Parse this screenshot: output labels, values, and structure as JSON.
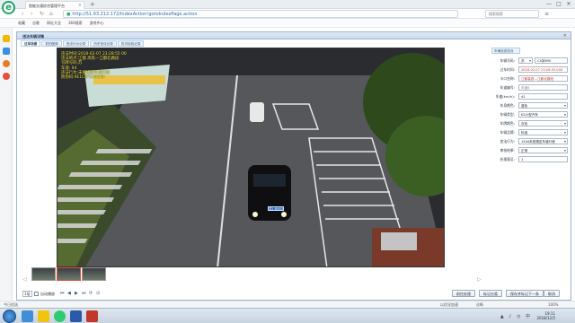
{
  "browser": {
    "logo": "e",
    "tab_title": "智能交通综合管理平台",
    "tab_close": "×",
    "new_tab": "+",
    "url": "http://51.93.212.172/IndexAction!gotoIndexPage.action",
    "search_placeholder": "搜索搜索",
    "window_controls": [
      "—",
      "□",
      "✕"
    ]
  },
  "bookmarks": [
    "收藏",
    "谷歌",
    "网址大全",
    "360搜索",
    "游戏中心"
  ],
  "app": {
    "title": "违法车辆详情",
    "subtabs": [
      "过车场景",
      "抓拍图像",
      "违法行为记录",
      "历史违法记录",
      "历次检验记录"
    ],
    "close": "✕"
  },
  "osd": {
    "lines": [
      "违法时间:2018-02-07 23:28:55 00",
      "违法地点:江都 高铁—江都北路段",
      "号牌号码:苏",
      "车道: 04",
      "违法行为:未按规定车道行驶",
      "防伪码:9E1C8F5A9E4B"
    ],
    "plate": "苏L·B563"
  },
  "form": {
    "header": "车辆信息校对",
    "rows": [
      {
        "label": "车辆号码:",
        "value": "苏",
        "extra": "CX新690",
        "style": "split"
      },
      {
        "label": "过车时间:",
        "value": "2018-02-07 23:28:55.000",
        "style": "red"
      },
      {
        "label": "卡口名称:",
        "value": "江都高铁—江都北路段",
        "style": "red"
      },
      {
        "label": "车道编号:",
        "value": "车道4",
        "style": "muted"
      },
      {
        "label": "车速(km/h):",
        "value": "41",
        "style": ""
      },
      {
        "label": "车身颜色:",
        "value": "蓝色",
        "style": "select"
      },
      {
        "label": "车辆类型:",
        "value": "K2小型汽车",
        "style": "select"
      },
      {
        "label": "车牌颜色:",
        "value": "灰色",
        "style": "select"
      },
      {
        "label": "车辆品牌:",
        "value": "标准",
        "style": "select"
      },
      {
        "label": "违法行为:",
        "value": "1344未按规定车道行驶",
        "style": "select"
      },
      {
        "label": "审核结果:",
        "value": "正常",
        "style": "select"
      },
      {
        "label": "处理意见:",
        "value": "1",
        "style": ""
      }
    ]
  },
  "toolbar": {
    "speed": "1倍",
    "auto_label": "自动播放",
    "controls": [
      "⏮",
      "◀",
      "▶",
      "⏭",
      "⟳",
      "⊙"
    ],
    "buttons": [
      "前往处理",
      "标记分类",
      "保存并标记下一条",
      "取消"
    ]
  },
  "status": {
    "left": "今日优选",
    "items": [
      "以优化加速",
      "诊断",
      "100%"
    ]
  },
  "taskbar": {
    "time": "19:11",
    "date": "2018/12/5",
    "tray_icons": "▲ ♪ ◷ 中"
  },
  "colors": {
    "osd_text": "#f4e640",
    "accent": "#1d5fa8",
    "error_text": "#c0392b"
  }
}
